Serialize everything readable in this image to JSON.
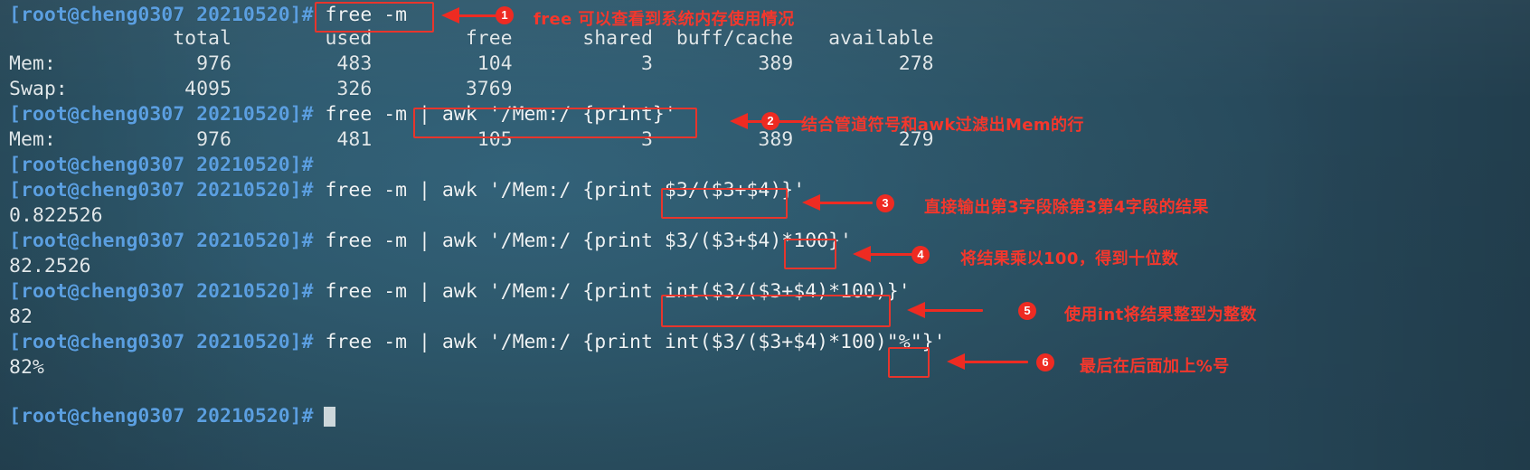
{
  "terminal": {
    "prompt": "[root@cheng0307 20210520]#",
    "colors": {
      "background": "#2d5668",
      "prompt_text": "#5b9fe0",
      "output_text": "#e9eef0",
      "annotation_red": "#ee2b22",
      "badge_red": "#ee2b22"
    },
    "lines": [
      {
        "type": "command",
        "cmd": " free -m"
      },
      {
        "type": "output",
        "text": "              total        used        free      shared  buff/cache   available"
      },
      {
        "type": "output",
        "text": "Mem:            976         483         104           3         389         278"
      },
      {
        "type": "output",
        "text": "Swap:          4095         326        3769"
      },
      {
        "type": "command",
        "cmd": " free -m | awk '/Mem:/ {print}'"
      },
      {
        "type": "output",
        "text": "Mem:            976         481         105           3         389         279"
      },
      {
        "type": "command",
        "cmd": ""
      },
      {
        "type": "command",
        "cmd": " free -m | awk '/Mem:/ {print $3/($3+$4)}'"
      },
      {
        "type": "output",
        "text": "0.822526"
      },
      {
        "type": "command",
        "cmd": " free -m | awk '/Mem:/ {print $3/($3+$4)*100}'"
      },
      {
        "type": "output",
        "text": "82.2526"
      },
      {
        "type": "command",
        "cmd": " free -m | awk '/Mem:/ {print int($3/($3+$4)*100)}'"
      },
      {
        "type": "output",
        "text": "82"
      },
      {
        "type": "command",
        "cmd": " free -m | awk '/Mem:/ {print int($3/($3+$4)*100)\"%\"}'"
      },
      {
        "type": "output",
        "text": "82%"
      },
      {
        "type": "command",
        "cmd": ""
      }
    ]
  },
  "annotations": [
    {
      "number": "1",
      "text": "free 可以查看到系统内存使用情况",
      "highlight": "free -m"
    },
    {
      "number": "2",
      "text": "结合管道符号和awk过滤出Mem的行",
      "highlight": "| awk '/Mem:/ {print}'"
    },
    {
      "number": "3",
      "text": "直接输出第3字段除第3第4字段的结果",
      "highlight": "$3/($3+$4)}"
    },
    {
      "number": "4",
      "text": "将结果乘以100，得到十位数",
      "highlight": "*100"
    },
    {
      "number": "5",
      "text": "使用int将结果整型为整数",
      "highlight": "int($3/($3+$4)*100)"
    },
    {
      "number": "6",
      "text": "最后在后面加上%号",
      "highlight": "\"%\""
    }
  ]
}
